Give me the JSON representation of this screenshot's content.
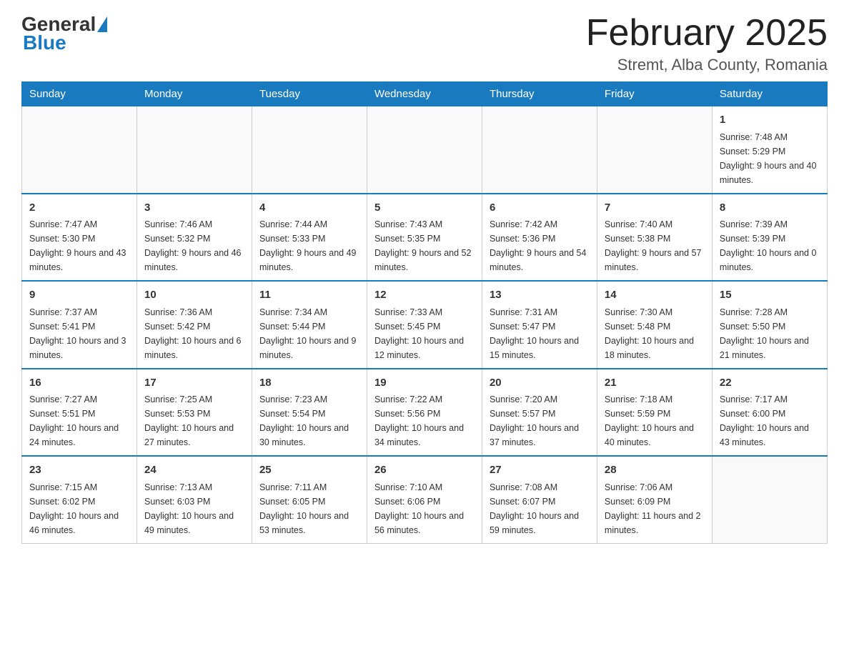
{
  "header": {
    "logo": {
      "general": "General",
      "blue": "Blue"
    },
    "title": "February 2025",
    "location": "Stremt, Alba County, Romania"
  },
  "days_of_week": [
    "Sunday",
    "Monday",
    "Tuesday",
    "Wednesday",
    "Thursday",
    "Friday",
    "Saturday"
  ],
  "weeks": [
    [
      {
        "day": "",
        "info": ""
      },
      {
        "day": "",
        "info": ""
      },
      {
        "day": "",
        "info": ""
      },
      {
        "day": "",
        "info": ""
      },
      {
        "day": "",
        "info": ""
      },
      {
        "day": "",
        "info": ""
      },
      {
        "day": "1",
        "info": "Sunrise: 7:48 AM\nSunset: 5:29 PM\nDaylight: 9 hours and 40 minutes."
      }
    ],
    [
      {
        "day": "2",
        "info": "Sunrise: 7:47 AM\nSunset: 5:30 PM\nDaylight: 9 hours and 43 minutes."
      },
      {
        "day": "3",
        "info": "Sunrise: 7:46 AM\nSunset: 5:32 PM\nDaylight: 9 hours and 46 minutes."
      },
      {
        "day": "4",
        "info": "Sunrise: 7:44 AM\nSunset: 5:33 PM\nDaylight: 9 hours and 49 minutes."
      },
      {
        "day": "5",
        "info": "Sunrise: 7:43 AM\nSunset: 5:35 PM\nDaylight: 9 hours and 52 minutes."
      },
      {
        "day": "6",
        "info": "Sunrise: 7:42 AM\nSunset: 5:36 PM\nDaylight: 9 hours and 54 minutes."
      },
      {
        "day": "7",
        "info": "Sunrise: 7:40 AM\nSunset: 5:38 PM\nDaylight: 9 hours and 57 minutes."
      },
      {
        "day": "8",
        "info": "Sunrise: 7:39 AM\nSunset: 5:39 PM\nDaylight: 10 hours and 0 minutes."
      }
    ],
    [
      {
        "day": "9",
        "info": "Sunrise: 7:37 AM\nSunset: 5:41 PM\nDaylight: 10 hours and 3 minutes."
      },
      {
        "day": "10",
        "info": "Sunrise: 7:36 AM\nSunset: 5:42 PM\nDaylight: 10 hours and 6 minutes."
      },
      {
        "day": "11",
        "info": "Sunrise: 7:34 AM\nSunset: 5:44 PM\nDaylight: 10 hours and 9 minutes."
      },
      {
        "day": "12",
        "info": "Sunrise: 7:33 AM\nSunset: 5:45 PM\nDaylight: 10 hours and 12 minutes."
      },
      {
        "day": "13",
        "info": "Sunrise: 7:31 AM\nSunset: 5:47 PM\nDaylight: 10 hours and 15 minutes."
      },
      {
        "day": "14",
        "info": "Sunrise: 7:30 AM\nSunset: 5:48 PM\nDaylight: 10 hours and 18 minutes."
      },
      {
        "day": "15",
        "info": "Sunrise: 7:28 AM\nSunset: 5:50 PM\nDaylight: 10 hours and 21 minutes."
      }
    ],
    [
      {
        "day": "16",
        "info": "Sunrise: 7:27 AM\nSunset: 5:51 PM\nDaylight: 10 hours and 24 minutes."
      },
      {
        "day": "17",
        "info": "Sunrise: 7:25 AM\nSunset: 5:53 PM\nDaylight: 10 hours and 27 minutes."
      },
      {
        "day": "18",
        "info": "Sunrise: 7:23 AM\nSunset: 5:54 PM\nDaylight: 10 hours and 30 minutes."
      },
      {
        "day": "19",
        "info": "Sunrise: 7:22 AM\nSunset: 5:56 PM\nDaylight: 10 hours and 34 minutes."
      },
      {
        "day": "20",
        "info": "Sunrise: 7:20 AM\nSunset: 5:57 PM\nDaylight: 10 hours and 37 minutes."
      },
      {
        "day": "21",
        "info": "Sunrise: 7:18 AM\nSunset: 5:59 PM\nDaylight: 10 hours and 40 minutes."
      },
      {
        "day": "22",
        "info": "Sunrise: 7:17 AM\nSunset: 6:00 PM\nDaylight: 10 hours and 43 minutes."
      }
    ],
    [
      {
        "day": "23",
        "info": "Sunrise: 7:15 AM\nSunset: 6:02 PM\nDaylight: 10 hours and 46 minutes."
      },
      {
        "day": "24",
        "info": "Sunrise: 7:13 AM\nSunset: 6:03 PM\nDaylight: 10 hours and 49 minutes."
      },
      {
        "day": "25",
        "info": "Sunrise: 7:11 AM\nSunset: 6:05 PM\nDaylight: 10 hours and 53 minutes."
      },
      {
        "day": "26",
        "info": "Sunrise: 7:10 AM\nSunset: 6:06 PM\nDaylight: 10 hours and 56 minutes."
      },
      {
        "day": "27",
        "info": "Sunrise: 7:08 AM\nSunset: 6:07 PM\nDaylight: 10 hours and 59 minutes."
      },
      {
        "day": "28",
        "info": "Sunrise: 7:06 AM\nSunset: 6:09 PM\nDaylight: 11 hours and 2 minutes."
      },
      {
        "day": "",
        "info": ""
      }
    ]
  ]
}
